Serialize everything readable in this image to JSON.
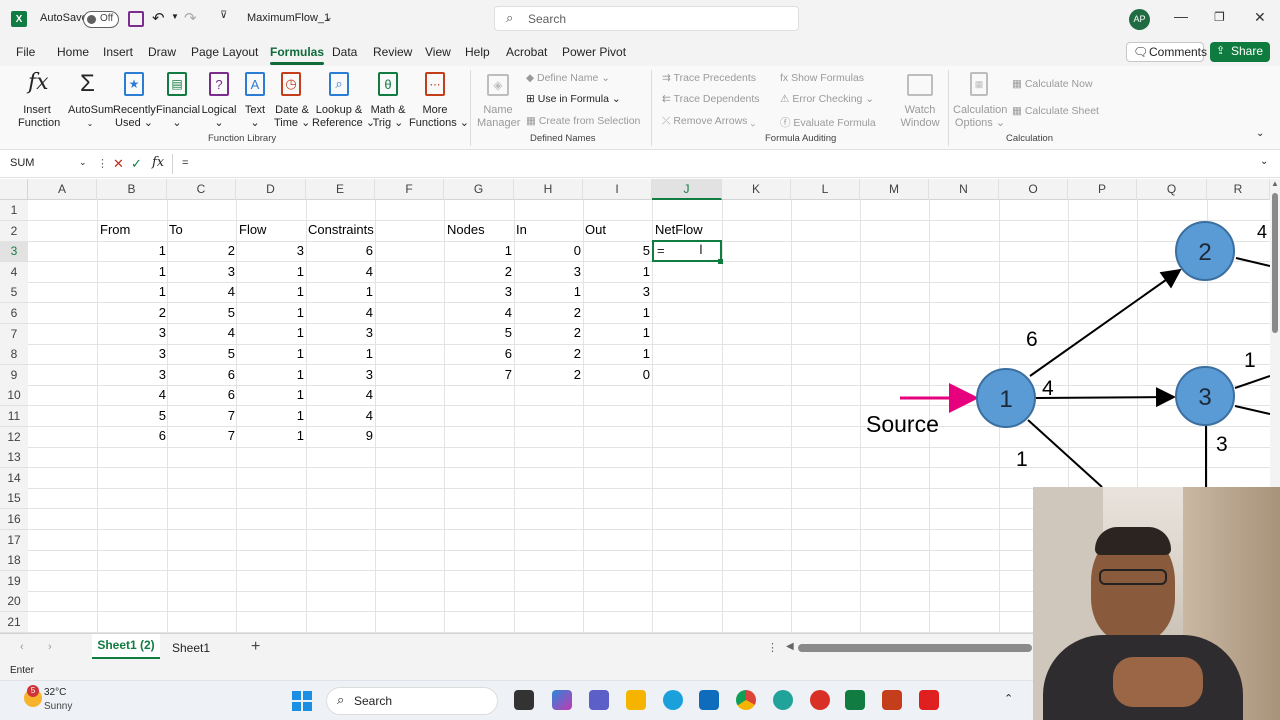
{
  "titlebar": {
    "autosave_label": "AutoSave",
    "autosave_state": "Off",
    "filename": "MaximumFlow_1",
    "search_placeholder": "Search",
    "avatar_initials": "AP"
  },
  "menu": {
    "items": [
      "File",
      "Home",
      "Insert",
      "Draw",
      "Page Layout",
      "Formulas",
      "Data",
      "Review",
      "View",
      "Help",
      "Acrobat",
      "Power Pivot"
    ],
    "active": "Formulas",
    "comments_label": "Comments",
    "share_label": "Share"
  },
  "ribbon": {
    "insert_function": [
      "Insert",
      "Function"
    ],
    "autosum": "AutoSum",
    "recently_used": [
      "Recently",
      "Used"
    ],
    "financial": "Financial",
    "logical": "Logical",
    "text": "Text",
    "date_time": [
      "Date &",
      "Time"
    ],
    "lookup": [
      "Lookup &",
      "Reference"
    ],
    "math": [
      "Math &",
      "Trig"
    ],
    "more": [
      "More",
      "Functions"
    ],
    "group_function_library": "Function Library",
    "name_manager": [
      "Name",
      "Manager"
    ],
    "define_name": "Define Name",
    "use_in_formula": "Use in Formula",
    "create_from_selection": "Create from Selection",
    "group_defined_names": "Defined Names",
    "trace_precedents": "Trace Precedents",
    "trace_dependents": "Trace Dependents",
    "remove_arrows": "Remove Arrows",
    "show_formulas": "Show Formulas",
    "error_checking": "Error Checking",
    "evaluate_formula": "Evaluate Formula",
    "watch_window": [
      "Watch",
      "Window"
    ],
    "group_formula_auditing": "Formula Auditing",
    "calculation_options": [
      "Calculation",
      "Options"
    ],
    "calculate_now": "Calculate Now",
    "calculate_sheet": "Calculate Sheet",
    "group_calculation": "Calculation"
  },
  "formula_bar": {
    "name_box": "SUM",
    "formula": "="
  },
  "columns": [
    "A",
    "B",
    "C",
    "D",
    "E",
    "F",
    "G",
    "H",
    "I",
    "J",
    "K",
    "L",
    "M",
    "N",
    "O",
    "P",
    "Q",
    "R"
  ],
  "rows": [
    "1",
    "2",
    "3",
    "4",
    "5",
    "6",
    "7",
    "8",
    "9",
    "10",
    "11",
    "12",
    "13",
    "14",
    "15",
    "16",
    "17",
    "18",
    "19",
    "20",
    "21"
  ],
  "headers": {
    "from": "From",
    "to": "To",
    "flow": "Flow",
    "constraints": "Constraints",
    "nodes": "Nodes",
    "in": "In",
    "out": "Out",
    "netflow": "NetFlow"
  },
  "edge_table": [
    [
      "1",
      "2",
      "3",
      "6"
    ],
    [
      "1",
      "3",
      "1",
      "4"
    ],
    [
      "1",
      "4",
      "1",
      "1"
    ],
    [
      "2",
      "5",
      "1",
      "4"
    ],
    [
      "3",
      "4",
      "1",
      "3"
    ],
    [
      "3",
      "5",
      "1",
      "1"
    ],
    [
      "3",
      "6",
      "1",
      "3"
    ],
    [
      "4",
      "6",
      "1",
      "4"
    ],
    [
      "5",
      "7",
      "1",
      "4"
    ],
    [
      "6",
      "7",
      "1",
      "9"
    ]
  ],
  "node_table": [
    [
      "1",
      "0",
      "5"
    ],
    [
      "2",
      "3",
      "1"
    ],
    [
      "3",
      "1",
      "3"
    ],
    [
      "4",
      "2",
      "1"
    ],
    [
      "5",
      "2",
      "1"
    ],
    [
      "6",
      "2",
      "1"
    ],
    [
      "7",
      "2",
      "0"
    ]
  ],
  "active_cell_value": "=",
  "graph": {
    "nodes": [
      "1",
      "2",
      "3"
    ],
    "edge_labels": [
      "6",
      "4",
      "1",
      "1",
      "3"
    ],
    "edge_partial_label": "4",
    "source_label": "Source"
  },
  "sheet_tabs": [
    "Sheet1 (2)",
    "Sheet1"
  ],
  "active_tab": "Sheet1 (2)",
  "status_mode": "Enter",
  "taskbar": {
    "weather_temp": "32°C",
    "weather_desc": "Sunny",
    "weather_badge": "5",
    "search_label": "Search"
  },
  "colors": {
    "excel_green": "#107c41",
    "node_fill": "#5b9bd5",
    "source_arrow": "#e6007e"
  }
}
